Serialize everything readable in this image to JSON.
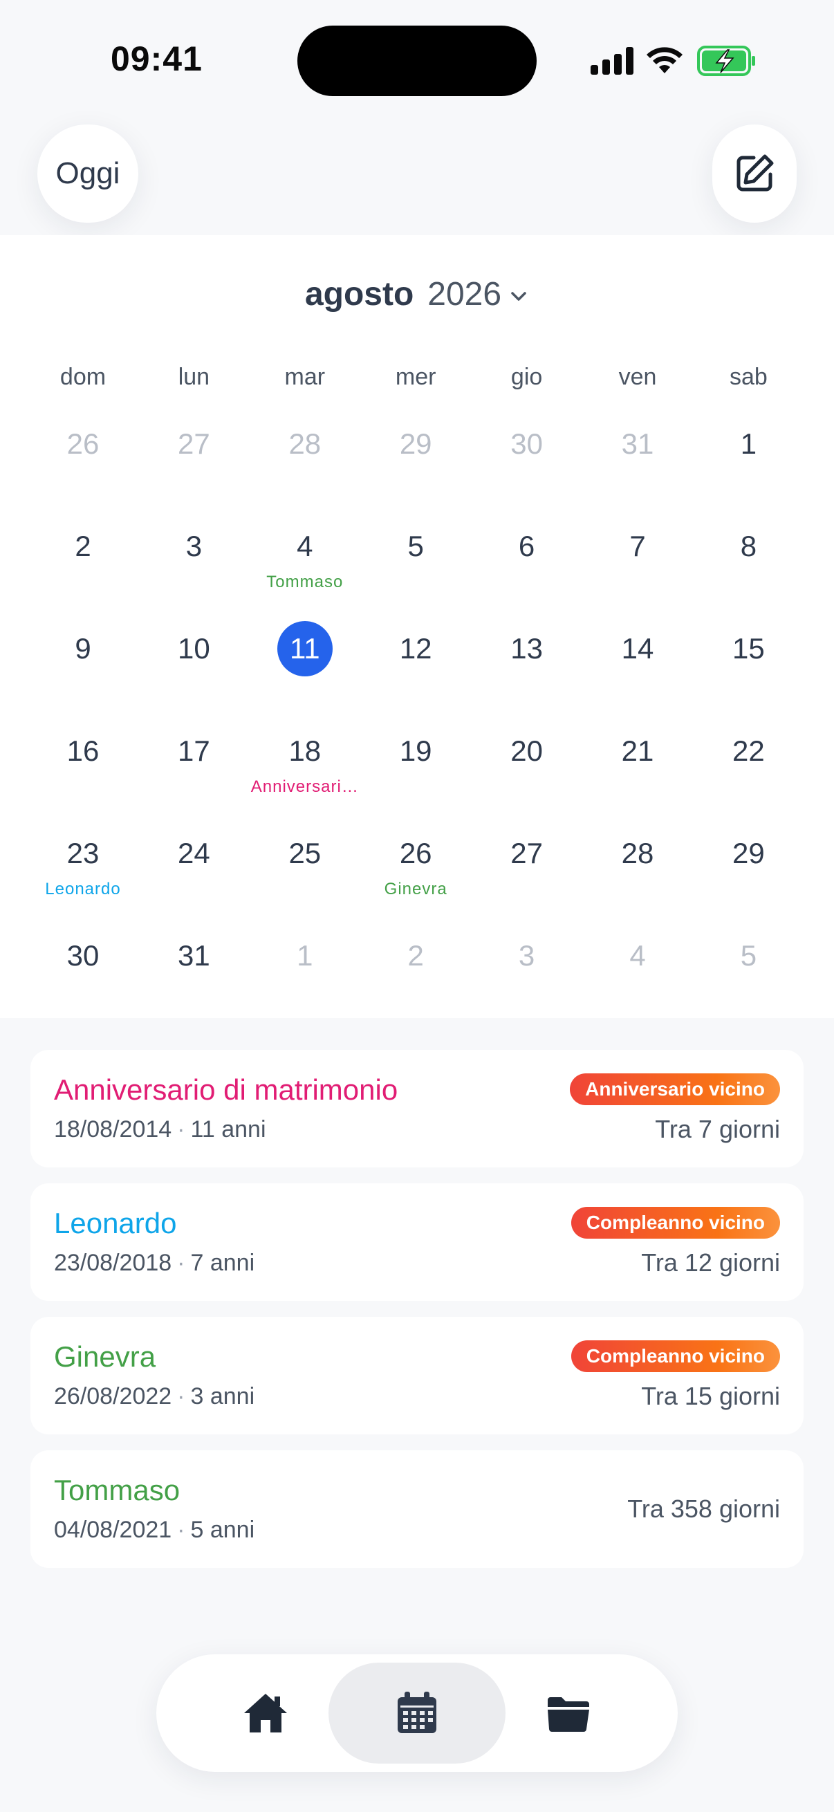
{
  "status_bar": {
    "time": "09:41"
  },
  "header": {
    "today_label": "Oggi"
  },
  "calendar": {
    "month": "agosto",
    "year": "2026",
    "weekdays": [
      "dom",
      "lun",
      "mar",
      "mer",
      "gio",
      "ven",
      "sab"
    ],
    "weeks": [
      [
        {
          "n": "26",
          "muted": true
        },
        {
          "n": "27",
          "muted": true
        },
        {
          "n": "28",
          "muted": true
        },
        {
          "n": "29",
          "muted": true
        },
        {
          "n": "30",
          "muted": true
        },
        {
          "n": "31",
          "muted": true
        },
        {
          "n": "1"
        }
      ],
      [
        {
          "n": "2"
        },
        {
          "n": "3"
        },
        {
          "n": "4",
          "label": "Tommaso",
          "label_color": "#43a047"
        },
        {
          "n": "5"
        },
        {
          "n": "6"
        },
        {
          "n": "7"
        },
        {
          "n": "8"
        }
      ],
      [
        {
          "n": "9"
        },
        {
          "n": "10"
        },
        {
          "n": "11",
          "today": true
        },
        {
          "n": "12"
        },
        {
          "n": "13"
        },
        {
          "n": "14"
        },
        {
          "n": "15"
        }
      ],
      [
        {
          "n": "16"
        },
        {
          "n": "17"
        },
        {
          "n": "18",
          "label": "Anniversari…",
          "label_color": "#e11d74"
        },
        {
          "n": "19"
        },
        {
          "n": "20"
        },
        {
          "n": "21"
        },
        {
          "n": "22"
        }
      ],
      [
        {
          "n": "23",
          "label": "Leonardo",
          "label_color": "#0ea5e9"
        },
        {
          "n": "24"
        },
        {
          "n": "25"
        },
        {
          "n": "26",
          "label": "Ginevra",
          "label_color": "#43a047"
        },
        {
          "n": "27"
        },
        {
          "n": "28"
        },
        {
          "n": "29"
        }
      ],
      [
        {
          "n": "30"
        },
        {
          "n": "31"
        },
        {
          "n": "1",
          "muted": true
        },
        {
          "n": "2",
          "muted": true
        },
        {
          "n": "3",
          "muted": true
        },
        {
          "n": "4",
          "muted": true
        },
        {
          "n": "5",
          "muted": true
        }
      ]
    ],
    "today_color": "#2563eb"
  },
  "events": [
    {
      "title": "Anniversario di matrimonio",
      "color": "#e11d74",
      "date": "18/08/2014",
      "age": "11 anni",
      "badge": "Anniversario vicino",
      "countdown": "Tra 7 giorni"
    },
    {
      "title": "Leonardo",
      "color": "#0ea5e9",
      "date": "23/08/2018",
      "age": "7 anni",
      "badge": "Compleanno vicino",
      "countdown": "Tra 12 giorni"
    },
    {
      "title": "Ginevra",
      "color": "#43a047",
      "date": "26/08/2022",
      "age": "3 anni",
      "badge": "Compleanno vicino",
      "countdown": "Tra 15 giorni"
    },
    {
      "title": "Tommaso",
      "color": "#43a047",
      "date": "04/08/2021",
      "age": "5 anni",
      "badge": "",
      "countdown": "Tra 358 giorni"
    }
  ],
  "tab_bar": {
    "tabs": [
      {
        "icon": "home-icon",
        "active": false
      },
      {
        "icon": "calendar-icon",
        "active": true
      },
      {
        "icon": "folder-icon",
        "active": false
      }
    ]
  }
}
